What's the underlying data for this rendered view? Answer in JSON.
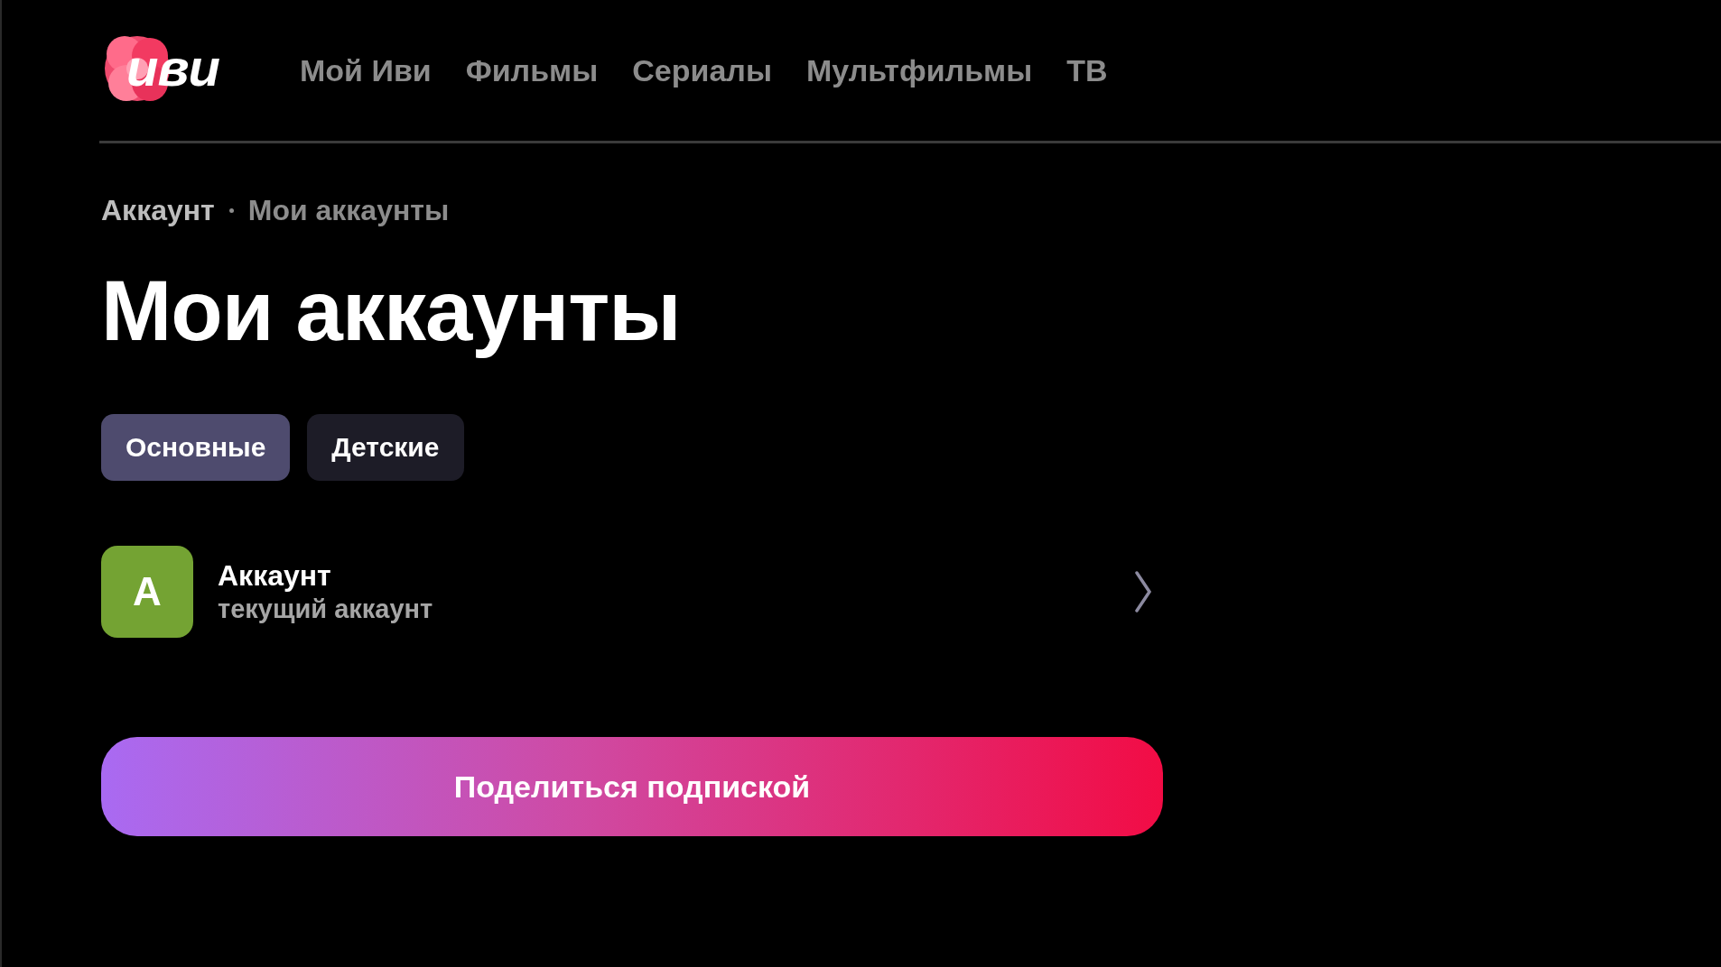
{
  "header": {
    "logo": "иви",
    "nav": [
      {
        "label": "Мой Иви"
      },
      {
        "label": "Фильмы"
      },
      {
        "label": "Сериалы"
      },
      {
        "label": "Мультфильмы"
      },
      {
        "label": "ТВ"
      }
    ]
  },
  "breadcrumbs": [
    {
      "label": "Аккаунт"
    },
    {
      "label": "Мои аккаунты"
    }
  ],
  "title": "Мои аккаунты",
  "tabs": [
    {
      "label": "Основные",
      "selected": true
    },
    {
      "label": "Детские",
      "selected": false
    }
  ],
  "accounts": [
    {
      "initial": "А",
      "name": "Аккаунт",
      "subtitle": "текущий аккаунт",
      "color": "#74a333"
    }
  ],
  "share_button": "Поделиться подпиской"
}
